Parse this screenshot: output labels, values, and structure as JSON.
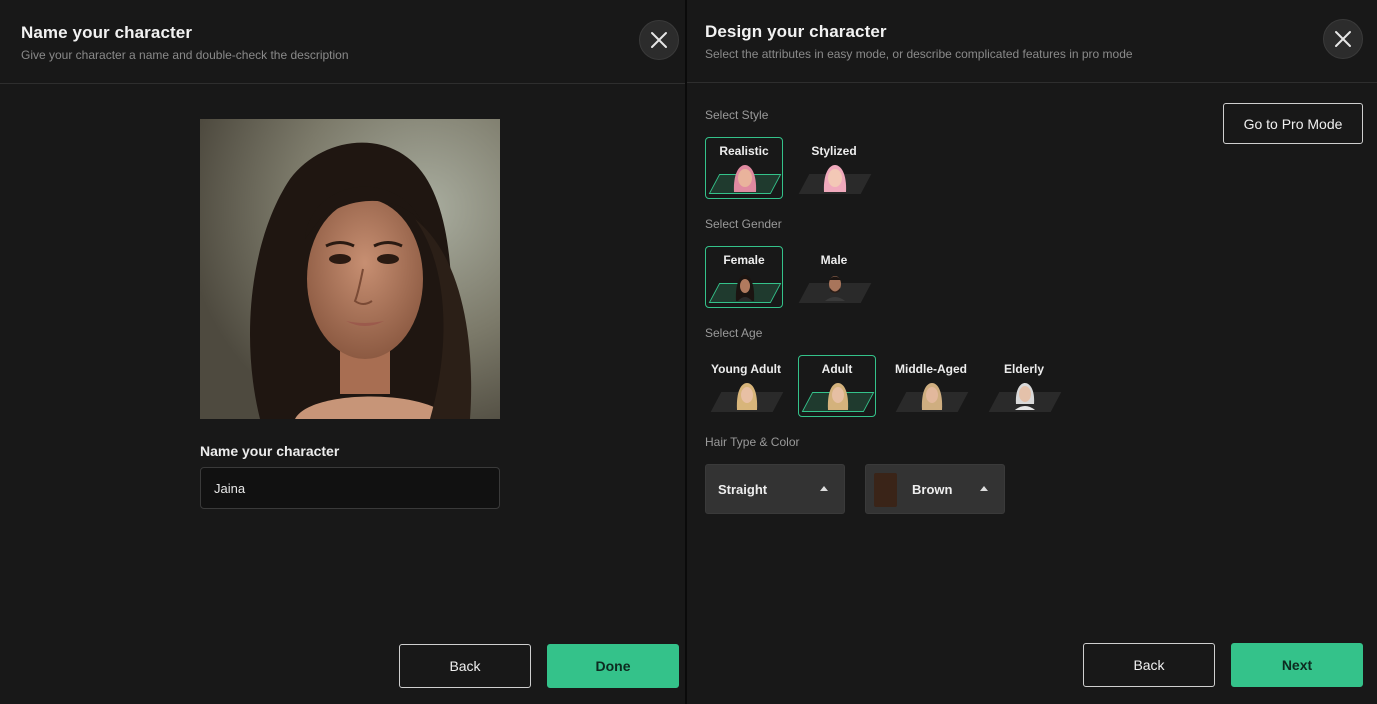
{
  "left_panel": {
    "title": "Name your character",
    "subtitle": "Give your character a name and double-check the description",
    "name_label": "Name your character",
    "name_value": "Jaina",
    "back_label": "Back",
    "done_label": "Done"
  },
  "right_panel": {
    "title": "Design your character",
    "subtitle": "Select the attributes in easy mode, or describe complicated features in pro mode",
    "pro_mode_label": "Go to Pro Mode",
    "style": {
      "label": "Select Style",
      "options": [
        {
          "label": "Realistic",
          "selected": true
        },
        {
          "label": "Stylized",
          "selected": false
        }
      ]
    },
    "gender": {
      "label": "Select Gender",
      "options": [
        {
          "label": "Female",
          "selected": true
        },
        {
          "label": "Male",
          "selected": false
        }
      ]
    },
    "age": {
      "label": "Select Age",
      "options": [
        {
          "label": "Young Adult",
          "selected": false
        },
        {
          "label": "Adult",
          "selected": true
        },
        {
          "label": "Middle-Aged",
          "selected": false
        },
        {
          "label": "Elderly",
          "selected": false
        }
      ]
    },
    "hair": {
      "label": "Hair Type & Color",
      "type_value": "Straight",
      "color_value": "Brown",
      "color_swatch": "#3a2418"
    },
    "back_label": "Back",
    "next_label": "Next"
  },
  "colors": {
    "accent": "#34c28a",
    "panel_bg": "#181818"
  },
  "icons": [
    "close-icon",
    "caret-up-icon"
  ]
}
